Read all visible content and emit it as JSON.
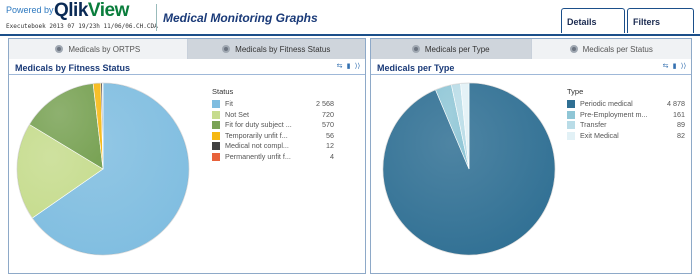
{
  "header": {
    "powered_by": "Powered by",
    "brand_q": "Qlik",
    "brand_v": "View",
    "build_text": "Executeboek 2013 07 19/23h 11/06/06.CH.CDA",
    "app_title": "Medical Monitoring Graphs",
    "buttons": {
      "details": "Details",
      "filters": "Filters"
    }
  },
  "left_panel": {
    "tabs": [
      {
        "label": "Medicals by ORTPS",
        "active": false
      },
      {
        "label": "Medicals by Fitness Status",
        "active": true
      }
    ],
    "chart_title": "Medicals by Fitness Status"
  },
  "right_panel": {
    "tabs": [
      {
        "label": "Medicals per Type",
        "active": true
      },
      {
        "label": "Medicals per Status",
        "active": false
      }
    ],
    "chart_title": "Medicals per Type"
  },
  "icons": [
    "export-icon",
    "bar-chart-icon",
    "restore-icon"
  ],
  "colors": {
    "header_border": "#1b4f8a",
    "title_blue": "#1a3a78"
  },
  "chart_data": [
    {
      "type": "pie",
      "title": "Medicals by Fitness Status",
      "legend_title": "Status",
      "legend_position": "right",
      "slices": [
        {
          "label": "Fit",
          "value": "2 568",
          "num": 2568,
          "color": "#7fbde0"
        },
        {
          "label": "Not Set",
          "value": "720",
          "num": 720,
          "color": "#c6dc8e"
        },
        {
          "label": "Fit for duty subject ...",
          "value": "570",
          "num": 570,
          "color": "#7aa356"
        },
        {
          "label": "Temporarily unfit f...",
          "value": "56",
          "num": 56,
          "color": "#f6b812"
        },
        {
          "label": "Medical not compl...",
          "value": "12",
          "num": 12,
          "color": "#404040"
        },
        {
          "label": "Permanently unfit f...",
          "value": "4",
          "num": 4,
          "color": "#e8623b"
        }
      ]
    },
    {
      "type": "pie",
      "title": "Medicals per Type",
      "legend_title": "Type",
      "legend_position": "right",
      "slices": [
        {
          "label": "Periodic medical",
          "value": "4 878",
          "num": 4878,
          "color": "#2f6f93"
        },
        {
          "label": "Pre-Employment m...",
          "value": "161",
          "num": 161,
          "color": "#8fc6d6"
        },
        {
          "label": "Transfer",
          "value": "89",
          "num": 89,
          "color": "#b9dce7"
        },
        {
          "label": "Exit Medical",
          "value": "82",
          "num": 82,
          "color": "#e2f1f6"
        }
      ]
    }
  ]
}
